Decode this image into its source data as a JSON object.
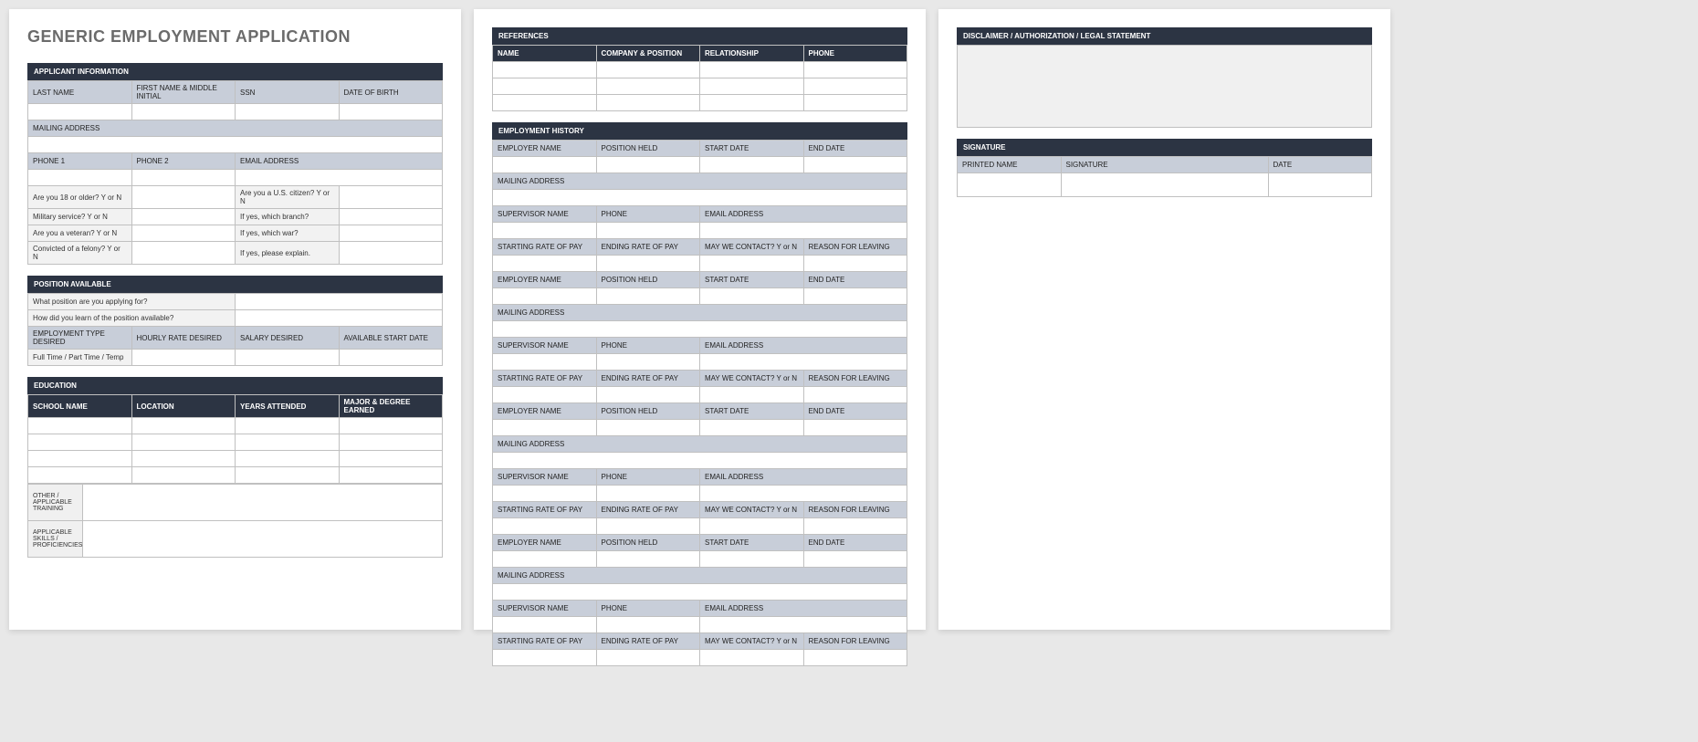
{
  "title": "GENERIC EMPLOYMENT APPLICATION",
  "page1": {
    "applicant_info": {
      "header": "APPLICANT INFORMATION",
      "last_name": "LAST NAME",
      "first_name": "FIRST NAME & MIDDLE INITIAL",
      "ssn": "SSN",
      "dob": "DATE OF BIRTH",
      "mailing": "MAILING ADDRESS",
      "phone1": "PHONE 1",
      "phone2": "PHONE 2",
      "email": "EMAIL ADDRESS",
      "q_18": "Are you 18 or older?  Y or N",
      "q_citizen": "Are you a U.S. citizen?  Y or N",
      "q_military": "Military service?  Y or N",
      "q_branch": "If yes, which branch?",
      "q_veteran": "Are you a veteran?  Y or N",
      "q_war": "If yes, which war?",
      "q_felony": "Convicted of a felony?  Y or N",
      "q_explain": "If yes, please explain."
    },
    "position": {
      "header": "POSITION AVAILABLE",
      "q_apply": "What position are you applying for?",
      "q_learn": "How did you learn of the position available?",
      "emp_type": "EMPLOYMENT TYPE DESIRED",
      "rate": "HOURLY RATE DESIRED",
      "salary": "SALARY DESIRED",
      "start": "AVAILABLE START DATE",
      "ft_pt": "Full Time / Part Time / Temp"
    },
    "education": {
      "header": "EDUCATION",
      "school": "SCHOOL NAME",
      "location": "LOCATION",
      "years": "YEARS ATTENDED",
      "degree": "MAJOR & DEGREE EARNED",
      "other": "OTHER / APPLICABLE TRAINING",
      "skills": "APPLICABLE SKILLS / PROFICIENCIES"
    }
  },
  "page2": {
    "references": {
      "header": "REFERENCES",
      "name": "NAME",
      "company": "COMPANY & POSITION",
      "relationship": "RELATIONSHIP",
      "phone": "PHONE"
    },
    "history": {
      "header": "EMPLOYMENT HISTORY",
      "employer": "EMPLOYER NAME",
      "position": "POSITION HELD",
      "start": "START DATE",
      "end": "END DATE",
      "mailing": "MAILING ADDRESS",
      "supervisor": "SUPERVISOR NAME",
      "phone": "PHONE",
      "email": "EMAIL ADDRESS",
      "start_pay": "STARTING RATE OF PAY",
      "end_pay": "ENDING RATE OF PAY",
      "contact": "MAY WE CONTACT? Y or N",
      "reason": "REASON FOR LEAVING"
    }
  },
  "page3": {
    "disclaimer": {
      "header": "DISCLAIMER / AUTHORIZATION / LEGAL STATEMENT"
    },
    "signature": {
      "header": "SIGNATURE",
      "printed": "PRINTED NAME",
      "sig": "SIGNATURE",
      "date": "DATE"
    }
  }
}
